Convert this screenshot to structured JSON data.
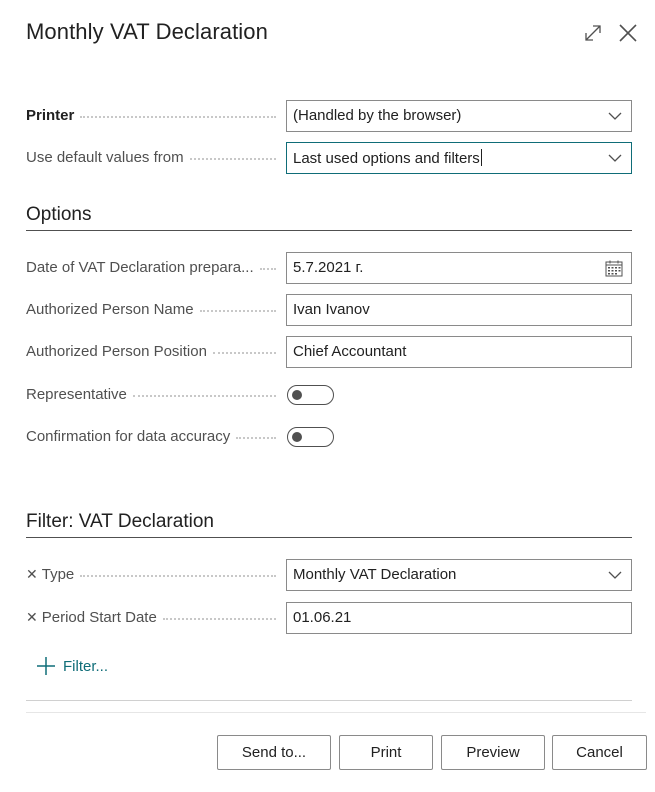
{
  "dialog": {
    "title": "Monthly VAT Declaration",
    "expand_icon": "expand-diagonal-icon",
    "close_icon": "close-icon"
  },
  "request": {
    "printer": {
      "label": "Printer",
      "value": "(Handled by the browser)"
    },
    "defaults": {
      "label": "Use default values from",
      "value": "Last used options and filters"
    }
  },
  "options": {
    "title": "Options",
    "date": {
      "label": "Date of VAT Declaration prepara...",
      "value": "5.7.2021 г."
    },
    "person_name": {
      "label": "Authorized Person Name",
      "value": "Ivan Ivanov"
    },
    "person_position": {
      "label": "Authorized Person Position",
      "value": "Chief Accountant"
    },
    "representative": {
      "label": "Representative",
      "on": false
    },
    "confirmation": {
      "label": "Confirmation for data accuracy",
      "on": false
    }
  },
  "filter": {
    "title": "Filter: VAT Declaration",
    "type": {
      "label": "Type",
      "value": "Monthly VAT Declaration"
    },
    "period": {
      "label": "Period Start Date",
      "value": "01.06.21"
    },
    "add_label": "Filter..."
  },
  "footer": {
    "send_to": "Send to...",
    "print": "Print",
    "preview": "Preview",
    "cancel": "Cancel"
  },
  "colors": {
    "accent": "#0f6d78",
    "text": "#212121",
    "label": "#505050"
  }
}
